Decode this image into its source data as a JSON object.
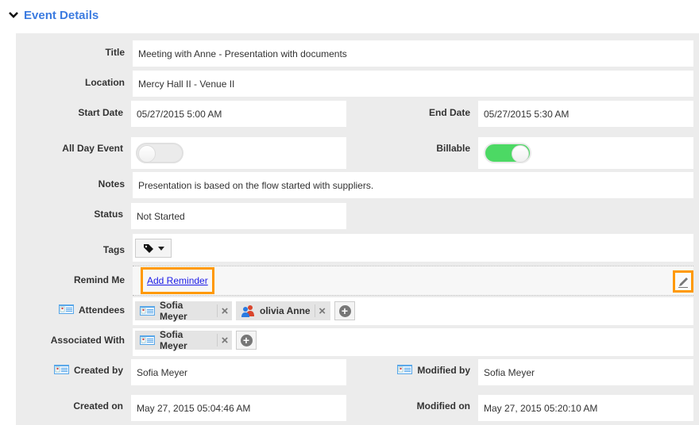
{
  "section": {
    "title": "Event Details",
    "icon": "chevron-down-icon"
  },
  "fields": {
    "title": {
      "label": "Title",
      "value": "Meeting with Anne - Presentation with documents"
    },
    "location": {
      "label": "Location",
      "value": "Mercy Hall II - Venue II"
    },
    "start_date": {
      "label": "Start Date",
      "value": "05/27/2015 5:00 AM"
    },
    "end_date": {
      "label": "End Date",
      "value": "05/27/2015 5:30 AM"
    },
    "all_day_event": {
      "label": "All Day Event",
      "value": false
    },
    "billable": {
      "label": "Billable",
      "value": true
    },
    "notes": {
      "label": "Notes",
      "value": "Presentation is based on the flow started with suppliers."
    },
    "status": {
      "label": "Status",
      "value": "Not Started"
    },
    "tags": {
      "label": "Tags",
      "icon": "tag-icon"
    },
    "remind_me": {
      "label": "Remind Me",
      "link": "Add Reminder",
      "edit_icon": "pencil-icon"
    },
    "attendees": {
      "label": "Attendees",
      "items": [
        {
          "name": "Sofia Meyer",
          "icon": "contact-card-icon"
        },
        {
          "name": "olivia Anne",
          "icon": "users-group-icon"
        }
      ]
    },
    "associated_with": {
      "label": "Associated With",
      "items": [
        {
          "name": "Sofia Meyer",
          "icon": "contact-card-icon"
        }
      ]
    },
    "created_by": {
      "label": "Created by",
      "value": "Sofia Meyer"
    },
    "modified_by": {
      "label": "Modified by",
      "value": "Sofia Meyer"
    },
    "created_on": {
      "label": "Created on",
      "value": "May 27, 2015 05:04:46 AM"
    },
    "modified_on": {
      "label": "Modified on",
      "value": "May 27, 2015 05:20:10 AM"
    }
  },
  "colors": {
    "accent": "#3b7be0",
    "toggle_on": "#4cd964",
    "highlight": "#ff9900",
    "panel_bg": "#ececec"
  }
}
